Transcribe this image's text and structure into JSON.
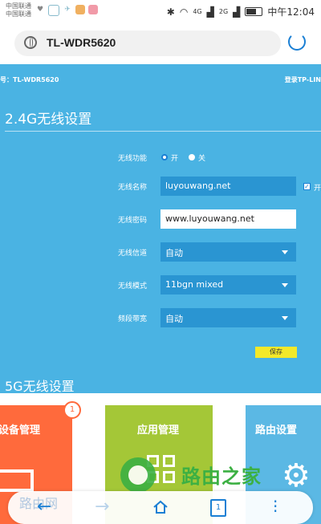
{
  "status_bar": {
    "carrier_1": "中国联通",
    "carrier_2": "中国联通",
    "network_1": "4G",
    "network_2": "2G",
    "time": "中午12:04"
  },
  "address_bar": {
    "url": "TL-WDR5620",
    "globe_icon": "globe-icon",
    "reload_icon": "reload-icon"
  },
  "router_header": {
    "model_text": "号：TL-WDR5620",
    "login_text": "登录TP-LIN"
  },
  "wifi_24g": {
    "section_title": "2.4G无线设置",
    "wireless_function": {
      "label": "无线功能",
      "on_label": "开",
      "off_label": "关",
      "selected": "开"
    },
    "wireless_name": {
      "label": "无线名称",
      "value": "luyouwang.net",
      "hide_checkbox_label": "开"
    },
    "wireless_password": {
      "label": "无线密码",
      "value": "www.luyouwang.net"
    },
    "wireless_channel": {
      "label": "无线信道",
      "value": "自动"
    },
    "wireless_mode": {
      "label": "无线模式",
      "value": "11bgn mixed"
    },
    "bandwidth": {
      "label": "频段带宽",
      "value": "自动"
    },
    "save_label": "保存"
  },
  "wifi_5g": {
    "section_title": "5G无线设置"
  },
  "tiles": [
    {
      "title": "设备管理",
      "badge": "1",
      "color": "#ff6a3c"
    },
    {
      "title": "应用管理",
      "color": "#a4c737"
    },
    {
      "title": "路由设置",
      "color": "#5bb8e4"
    }
  ],
  "watermark": {
    "text": "路由之家",
    "router_text": "路由网"
  },
  "bottom_bar": {
    "tab_count": "1"
  },
  "colors": {
    "panel": "#4ab3e3",
    "accent": "#1a7fd4",
    "save": "#f3e92a"
  }
}
